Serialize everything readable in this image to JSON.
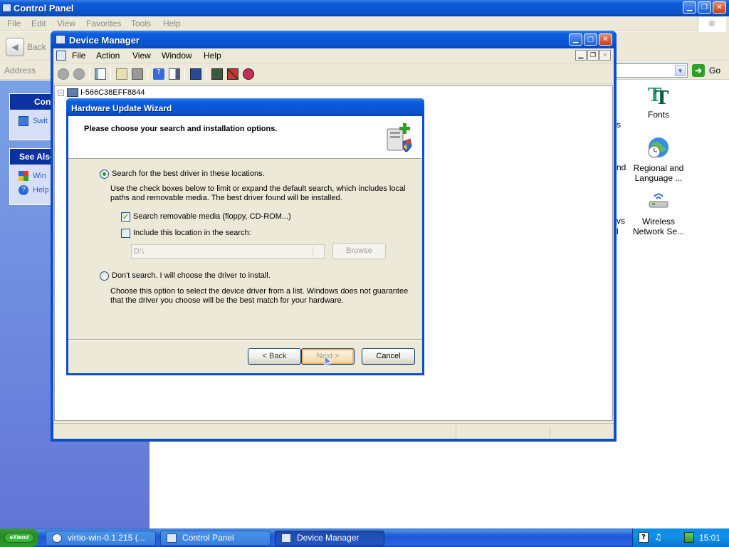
{
  "control_panel": {
    "title": "Control Panel",
    "menu": [
      "File",
      "Edit",
      "View",
      "Favorites",
      "Tools",
      "Help"
    ],
    "back_label": "Back",
    "address_label": "Address",
    "go_label": "Go",
    "left_panels": {
      "panel1_header": "Con",
      "panel1_link": "Swit",
      "see_also_header": "See Also",
      "see_also_links": [
        "Win",
        "Help"
      ]
    },
    "icons": [
      {
        "label": "Fonts",
        "icon": "fonts-icon"
      },
      {
        "label": "Regional and Language ...",
        "icon": "globe-clock-icon"
      },
      {
        "label": "Wireless Network Se...",
        "icon": "wireless-icon"
      }
    ],
    "partial_labels": [
      "s",
      "nd",
      "vs",
      "l"
    ]
  },
  "device_manager": {
    "title": "Device Manager",
    "menu": [
      "File",
      "Action",
      "View",
      "Window",
      "Help"
    ],
    "tree_root": "I-566C38EFF8844"
  },
  "wizard": {
    "title": "Hardware Update Wizard",
    "header": "Please choose your search and installation options.",
    "option_search_label": "Search for the best driver in these locations.",
    "option_search_desc": "Use the check boxes below to limit or expand the default search, which includes local paths and removable media. The best driver found will be installed.",
    "option_search_selected": true,
    "check_removable_label": "Search removable media (floppy, CD-ROM...)",
    "check_removable_checked": true,
    "check_location_label": "Include this location in the search:",
    "check_location_checked": false,
    "location_value": "D:\\",
    "browse_label": "Browse",
    "option_manual_label": "Don't search. I will choose the driver to install.",
    "option_manual_desc": "Choose this option to select the device driver from a list.  Windows does not guarantee that the driver you choose will be the best match for your hardware.",
    "back_label": "< Back",
    "next_label": "Next >",
    "cancel_label": "Cancel"
  },
  "taskbar": {
    "start_label": "eXtend",
    "tasks": [
      {
        "label": "virtio-win-0.1.215 (...",
        "active": false
      },
      {
        "label": "Control Panel",
        "active": false
      },
      {
        "label": "Device Manager",
        "active": true
      }
    ],
    "clock": "15:01"
  },
  "colors": {
    "titlebar_blue": "#0a55d0",
    "dialog_face": "#ece9d8",
    "check_green": "#21a121",
    "link_blue": "#215dc6"
  }
}
